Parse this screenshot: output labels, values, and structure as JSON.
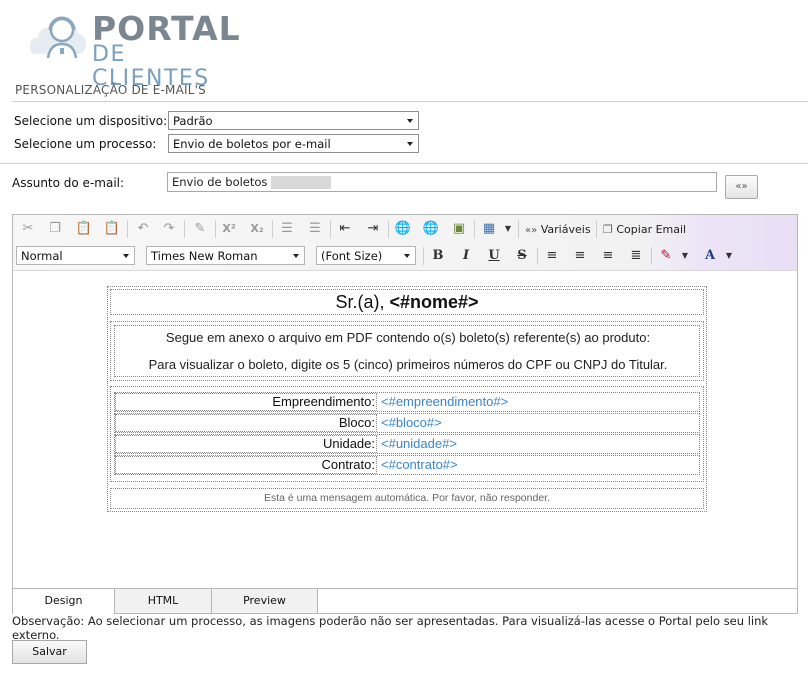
{
  "logo": {
    "line1": "PORTAL",
    "line2": "DE CLIENTES",
    "icon": "person-headset-icon"
  },
  "section": {
    "title": "PERSONALIZAÇÃO DE E-MAIL'S"
  },
  "form": {
    "device_label": "Selecione um dispositivo:",
    "device_value": "Padrão",
    "process_label": "Selecione um processo:",
    "process_value": "Envio de boletos por e-mail",
    "subject_label": "Assunto do e-mail:",
    "subject_value": "Envio de boletos",
    "variables_button_icon": "double-chevron-icon",
    "variables_button_label": "«»"
  },
  "toolbar": {
    "variables_label": "Variáveis",
    "copy_email_label": "Copiar Email",
    "format_value": "Normal",
    "font_value": "Times New Roman",
    "size_value": "(Font Size)",
    "superscript_label": "X²",
    "subscript_label": "X₂",
    "bold_label": "B",
    "italic_label": "I",
    "underline_label": "U",
    "strike_label": "S",
    "font_color_label": "A"
  },
  "email": {
    "greeting_prefix": "Sr.(a), ",
    "greeting_var": "<#nome#>",
    "line1": "Segue em anexo o arquivo em PDF contendo o(s) boleto(s) referente(s) ao produto:",
    "line2": "Para visualizar o boleto, digite os 5 (cinco) primeiros números do CPF ou CNPJ do Titular.",
    "rows": [
      {
        "label": "Empreendimento:",
        "value": "<#empreendimento#>"
      },
      {
        "label": "Bloco:",
        "value": "<#bloco#>"
      },
      {
        "label": "Unidade:",
        "value": "<#unidade#>"
      },
      {
        "label": "Contrato:",
        "value": "<#contrato#>"
      }
    ],
    "footer": "Esta é uma mensagem automática. Por favor, não responder."
  },
  "tabs": [
    {
      "label": "Design",
      "active": true
    },
    {
      "label": "HTML",
      "active": false
    },
    {
      "label": "Preview",
      "active": false
    }
  ],
  "note": "Observação: Ao selecionar um processo, as imagens poderão não ser apresentadas. Para visualizá-las acesse o Portal pelo seu link externo.",
  "save_label": "Salvar",
  "colors": {
    "link_var": "#3a86c8",
    "logo_gray": "#7b8790",
    "logo_blue": "#7aa0bf"
  }
}
